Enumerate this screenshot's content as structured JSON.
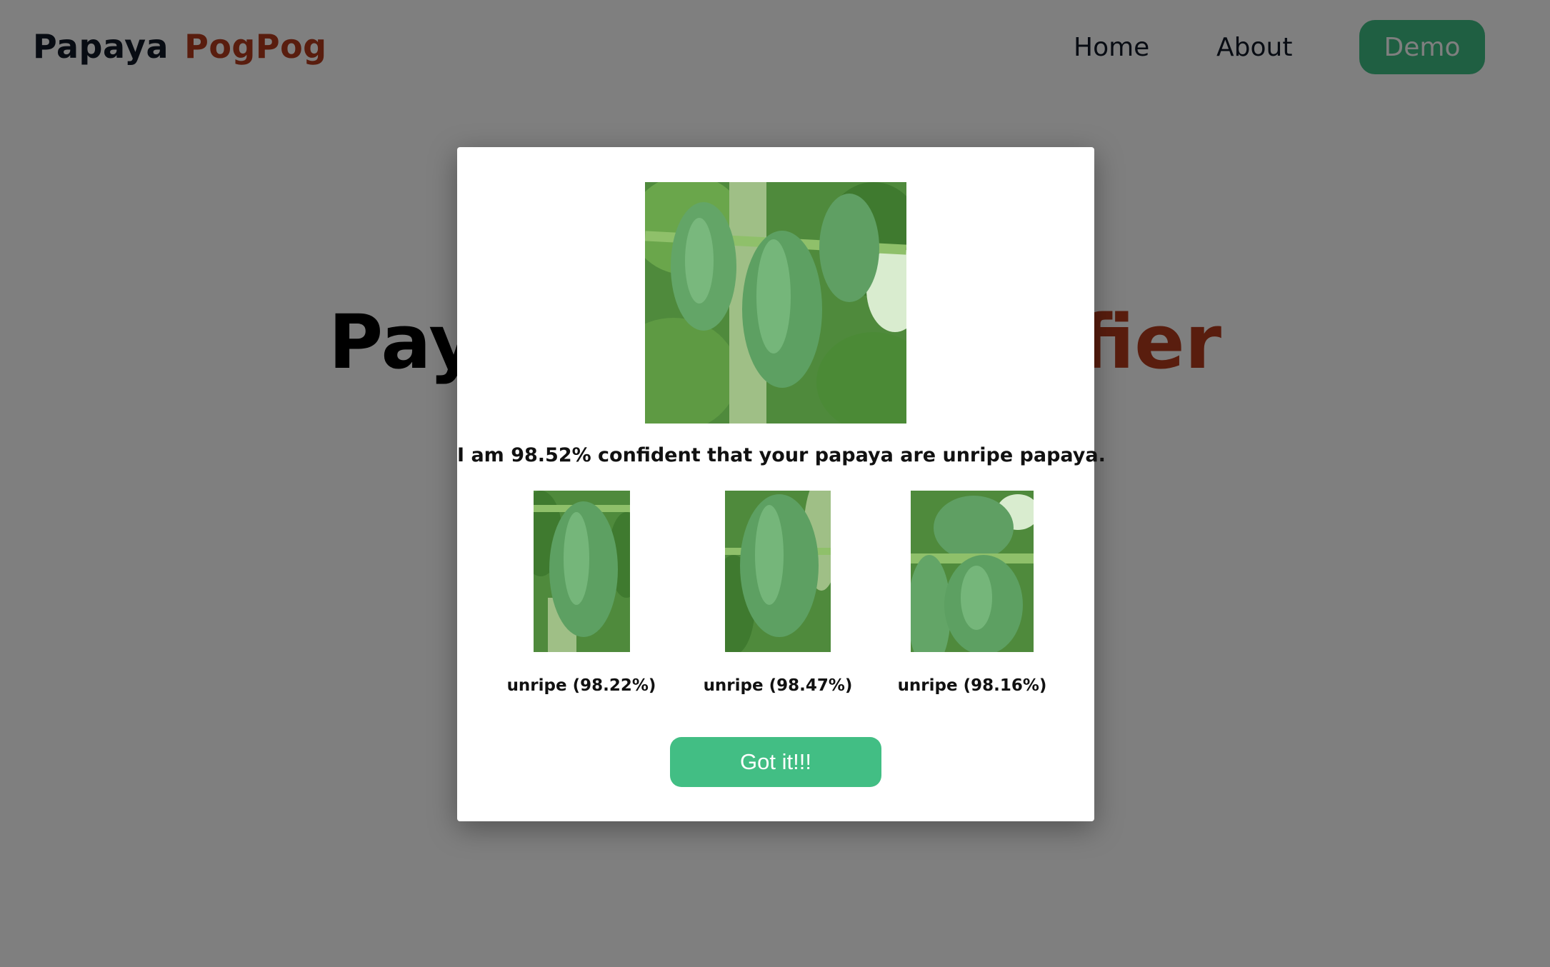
{
  "navbar": {
    "brand_part1": "Papaya",
    "brand_part2": "PogPog",
    "links": [
      {
        "label": "Home"
      },
      {
        "label": "About"
      }
    ],
    "demo_label": "Demo"
  },
  "hero": {
    "title_visible_left": "Pay",
    "title_visible_right": "ifier"
  },
  "modal": {
    "confidence_text": "I am 98.52% confident that your papaya are unripe papaya.",
    "predictions": [
      {
        "label": "unripe (98.22%)"
      },
      {
        "label": "unripe (98.47%)"
      },
      {
        "label": "unripe (98.16%)"
      }
    ],
    "button_label": "Got it!!!"
  },
  "colors": {
    "brand_accent": "#b23a1c",
    "button_green": "#42be84",
    "overlay": "rgba(0,0,0,0.5)"
  }
}
